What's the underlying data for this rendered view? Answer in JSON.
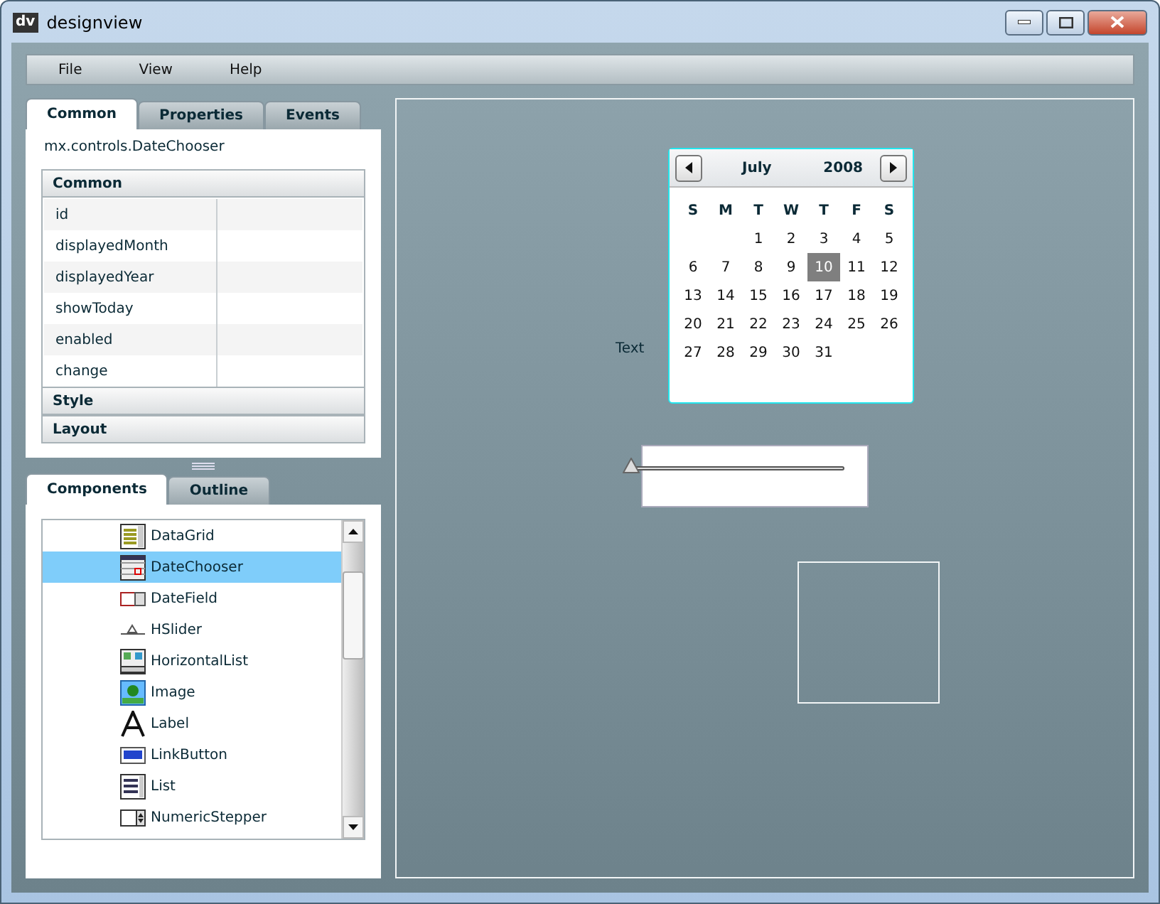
{
  "window": {
    "title": "designview",
    "logo": "dv"
  },
  "menu": [
    "File",
    "View",
    "Help"
  ],
  "inspector": {
    "tabs": [
      {
        "label": "Common",
        "selected": true
      },
      {
        "label": "Properties",
        "selected": false
      },
      {
        "label": "Events",
        "selected": false
      }
    ],
    "class_name": "mx.controls.DateChooser",
    "sections": [
      {
        "label": "Common",
        "expanded": true,
        "rows": [
          {
            "name": "id"
          },
          {
            "name": "displayedMonth"
          },
          {
            "name": "displayedYear"
          },
          {
            "name": "showToday"
          },
          {
            "name": "enabled"
          },
          {
            "name": "change"
          }
        ]
      },
      {
        "label": "Style",
        "expanded": false
      },
      {
        "label": "Layout",
        "expanded": false
      }
    ]
  },
  "palette": {
    "tabs": [
      {
        "label": "Components",
        "selected": true
      },
      {
        "label": "Outline",
        "selected": false
      }
    ],
    "items": [
      {
        "kind": "datagrid",
        "label": "DataGrid",
        "selected": false
      },
      {
        "kind": "datechooser",
        "label": "DateChooser",
        "selected": true
      },
      {
        "kind": "datefield",
        "label": "DateField",
        "selected": false
      },
      {
        "kind": "hslider",
        "label": "HSlider",
        "selected": false
      },
      {
        "kind": "hlist",
        "label": "HorizontalList",
        "selected": false
      },
      {
        "kind": "image",
        "label": "Image",
        "selected": false
      },
      {
        "kind": "label",
        "label": "Label",
        "selected": false
      },
      {
        "kind": "linkbutton",
        "label": "LinkButton",
        "selected": false
      },
      {
        "kind": "list",
        "label": "List",
        "selected": false
      },
      {
        "kind": "stepper",
        "label": "NumericStepper",
        "selected": false
      }
    ]
  },
  "canvas": {
    "label": {
      "text": "Text"
    },
    "date_chooser": {
      "month": "July",
      "year": "2008",
      "weekdays": [
        "S",
        "M",
        "T",
        "W",
        "T",
        "F",
        "S"
      ],
      "weeks": [
        {
          "right_aligned": true,
          "days": [
            {
              "label": "1",
              "selected": false
            },
            {
              "label": "2",
              "selected": false
            },
            {
              "label": "3",
              "selected": false
            },
            {
              "label": "4",
              "selected": false
            },
            {
              "label": "5",
              "selected": false
            }
          ]
        },
        {
          "days": [
            {
              "label": "6",
              "selected": false
            },
            {
              "label": "7",
              "selected": false
            },
            {
              "label": "8",
              "selected": false
            },
            {
              "label": "9",
              "selected": false
            },
            {
              "label": "10",
              "selected": true
            },
            {
              "label": "11",
              "selected": false
            },
            {
              "label": "12",
              "selected": false
            }
          ]
        },
        {
          "days": [
            {
              "label": "13",
              "selected": false
            },
            {
              "label": "14",
              "selected": false
            },
            {
              "label": "15",
              "selected": false
            },
            {
              "label": "16",
              "selected": false
            },
            {
              "label": "17",
              "selected": false
            },
            {
              "label": "18",
              "selected": false
            },
            {
              "label": "19",
              "selected": false
            }
          ]
        },
        {
          "days": [
            {
              "label": "20",
              "selected": false
            },
            {
              "label": "21",
              "selected": false
            },
            {
              "label": "22",
              "selected": false
            },
            {
              "label": "23",
              "selected": false
            },
            {
              "label": "24",
              "selected": false
            },
            {
              "label": "25",
              "selected": false
            },
            {
              "label": "26",
              "selected": false
            }
          ]
        },
        {
          "right_aligned": false,
          "days": [
            {
              "label": "27",
              "selected": false
            },
            {
              "label": "28",
              "selected": false
            },
            {
              "label": "29",
              "selected": false
            },
            {
              "label": "30",
              "selected": false
            },
            {
              "label": "31",
              "selected": false
            }
          ]
        }
      ]
    },
    "slider": {
      "level": 0
    }
  }
}
